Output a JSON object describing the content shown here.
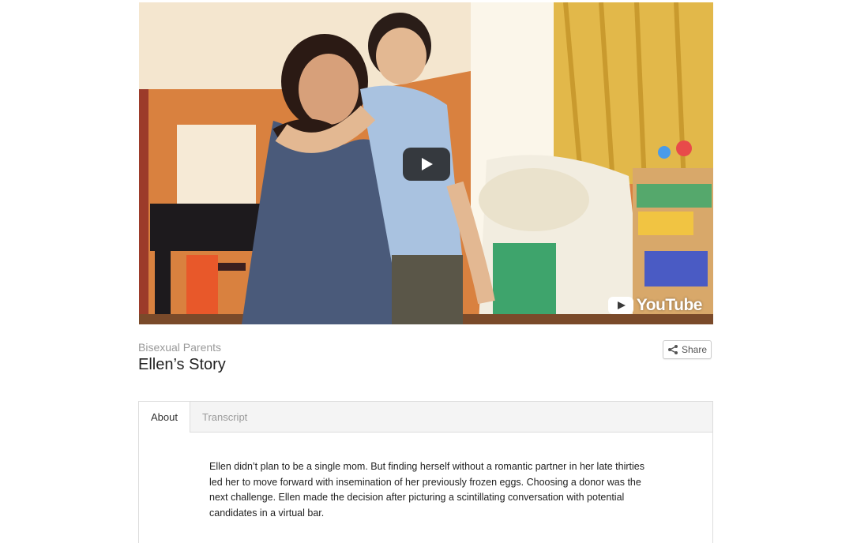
{
  "video": {
    "play_icon": "play-icon",
    "brand_label": "YouTube",
    "brand_icon": "youtube-icon"
  },
  "header": {
    "category": "Bisexual Parents",
    "title": "Ellen’s Story"
  },
  "share": {
    "label": "Share",
    "icon": "share-icon"
  },
  "tabs": [
    {
      "label": "About",
      "active": true
    },
    {
      "label": "Transcript",
      "active": false
    }
  ],
  "about": {
    "text": "Ellen didn’t plan to be a single mom. But finding herself without a romantic partner in her late thirties led her to move forward with insemination of her previously frozen eggs. Choosing a donor was the next challenge. Ellen made the decision after picturing a scintillating conversation with potential candidates in a virtual bar."
  },
  "colors": {
    "accent_text": "#222222",
    "muted_text": "#9a9a9a",
    "border": "#dcdcdc"
  }
}
